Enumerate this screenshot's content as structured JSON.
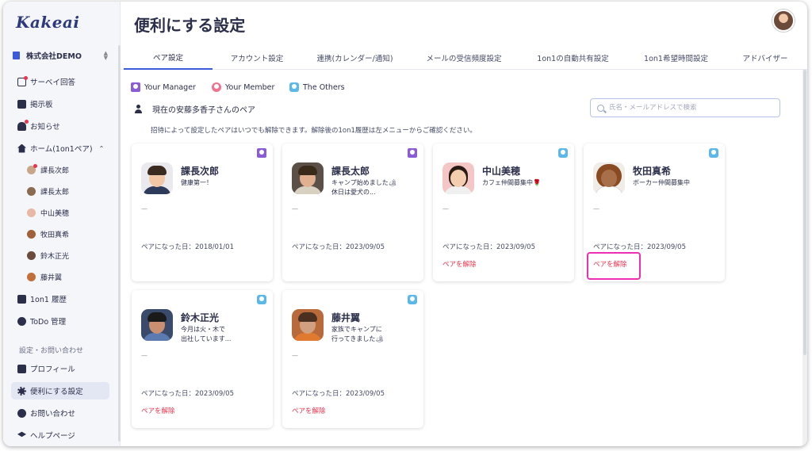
{
  "app": {
    "logo": "Kakeai",
    "page_title": "便利にする設定"
  },
  "sidebar": {
    "company": "株式会社DEMO",
    "items": [
      {
        "label": "サーベイ回答"
      },
      {
        "label": "掲示板"
      },
      {
        "label": "お知らせ"
      },
      {
        "label": "ホーム(1on1ペア)"
      },
      {
        "label": "1on1 履歴"
      },
      {
        "label": "ToDo 管理"
      },
      {
        "label": "プロフィール"
      },
      {
        "label": "便利にする設定"
      },
      {
        "label": "お問い合わせ"
      },
      {
        "label": "ヘルプページ"
      }
    ],
    "sub_items": [
      {
        "label": "課長次郎"
      },
      {
        "label": "課長太郎"
      },
      {
        "label": "中山美穂"
      },
      {
        "label": "牧田真希"
      },
      {
        "label": "鈴木正光"
      },
      {
        "label": "藤井翼"
      }
    ],
    "section_label": "設定・お問い合わせ"
  },
  "tabs": [
    {
      "label": "ペア設定"
    },
    {
      "label": "アカウント設定"
    },
    {
      "label": "連携(カレンダー/通知)"
    },
    {
      "label": "メールの受信頻度設定"
    },
    {
      "label": "1on1の自動共有設定"
    },
    {
      "label": "1on1希望時間設定"
    },
    {
      "label": "アドバイザー"
    }
  ],
  "legend": [
    {
      "label": "Your Manager",
      "color": "#8a5cd6"
    },
    {
      "label": "Your Member",
      "color": "#f0728f"
    },
    {
      "label": "The Others",
      "color": "#5cb8e8"
    }
  ],
  "pair_heading": "現在の安藤多香子さんのペア",
  "note": "招待によって設定したペアはいつでも解除できます。解除後の1on1履歴は左メニューからご確認ください。",
  "search": {
    "placeholder": "氏名・メールアドレスで検索"
  },
  "cards": [
    {
      "name": "課長次郎",
      "status": "健康第一！",
      "dash": "—",
      "date": "ペアになった日：2018/01/01",
      "unpair": ""
    },
    {
      "name": "課長太郎",
      "status": "キャンプ始めました🏕\n休日は愛犬の...",
      "dash": "—",
      "date": "ペアになった日：2023/09/05",
      "unpair": ""
    },
    {
      "name": "中山美穂",
      "status": "カフェ仲間募集中🌹",
      "dash": "—",
      "date": "ペアになった日：2023/09/05",
      "unpair": "ペアを解除"
    },
    {
      "name": "牧田真希",
      "status": "ボーカー仲間募集中",
      "dash": "—",
      "date": "ペアになった日：2023/09/05",
      "unpair": "ペアを解除"
    },
    {
      "name": "鈴木正光",
      "status": "今月は火・木で\n出社しています...",
      "dash": "—",
      "date": "ペアになった日：2023/09/05",
      "unpair": "ペアを解除"
    },
    {
      "name": "藤井翼",
      "status": "家族でキャンプに\n行ってきました🏕",
      "dash": "—",
      "date": "ペアになった日：2023/09/05",
      "unpair": "ペアを解除"
    }
  ]
}
